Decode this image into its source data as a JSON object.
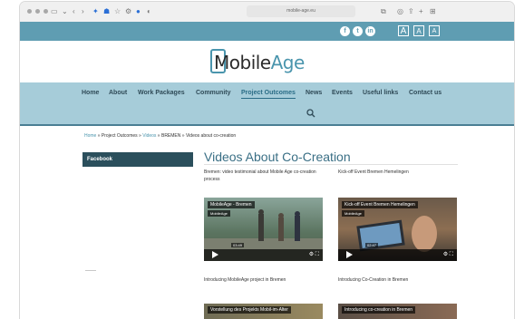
{
  "browser": {
    "url": "mobile-age.eu"
  },
  "topbar": {
    "social": [
      "f",
      "t",
      "in"
    ],
    "font_sizes": [
      "A",
      "A",
      "A"
    ]
  },
  "logo": {
    "part1": "Mobile",
    "part2": "Age"
  },
  "nav": {
    "items": [
      {
        "label": "Home"
      },
      {
        "label": "About"
      },
      {
        "label": "Work Packages"
      },
      {
        "label": "Community"
      },
      {
        "label": "Project Outcomes"
      },
      {
        "label": "News"
      },
      {
        "label": "Events"
      },
      {
        "label": "Useful links"
      },
      {
        "label": "Contact us"
      }
    ]
  },
  "breadcrumb": {
    "home": "Home",
    "sep": " » ",
    "outcomes": "Project Outcomes",
    "videos": "Videos",
    "bremen": "BREMEN",
    "current": "Videos about co-creation"
  },
  "sidebar": {
    "facebook_label": "Facebook"
  },
  "main": {
    "title": "Videos About Co-Creation",
    "captions": [
      "Bremen: video testimonial about Mobile Age co-creation process",
      "Kick-off Event Bremen Hemelingen",
      "Introducing MobileAge project in Bremen",
      "Introducing Co-Creation in Bremen"
    ],
    "videos": [
      {
        "title": "MobileAge - Bremen",
        "channel": "MobileAge",
        "time": "03:49"
      },
      {
        "title": "Kick-off Event Bremen Hemelingen",
        "channel": "MobileAge",
        "time": "02:47"
      }
    ],
    "partial_videos": [
      {
        "title": "Vorstellung des Projekts Mobil-im-Alter"
      },
      {
        "title": "Introducing co-creation in Bremen"
      }
    ]
  }
}
